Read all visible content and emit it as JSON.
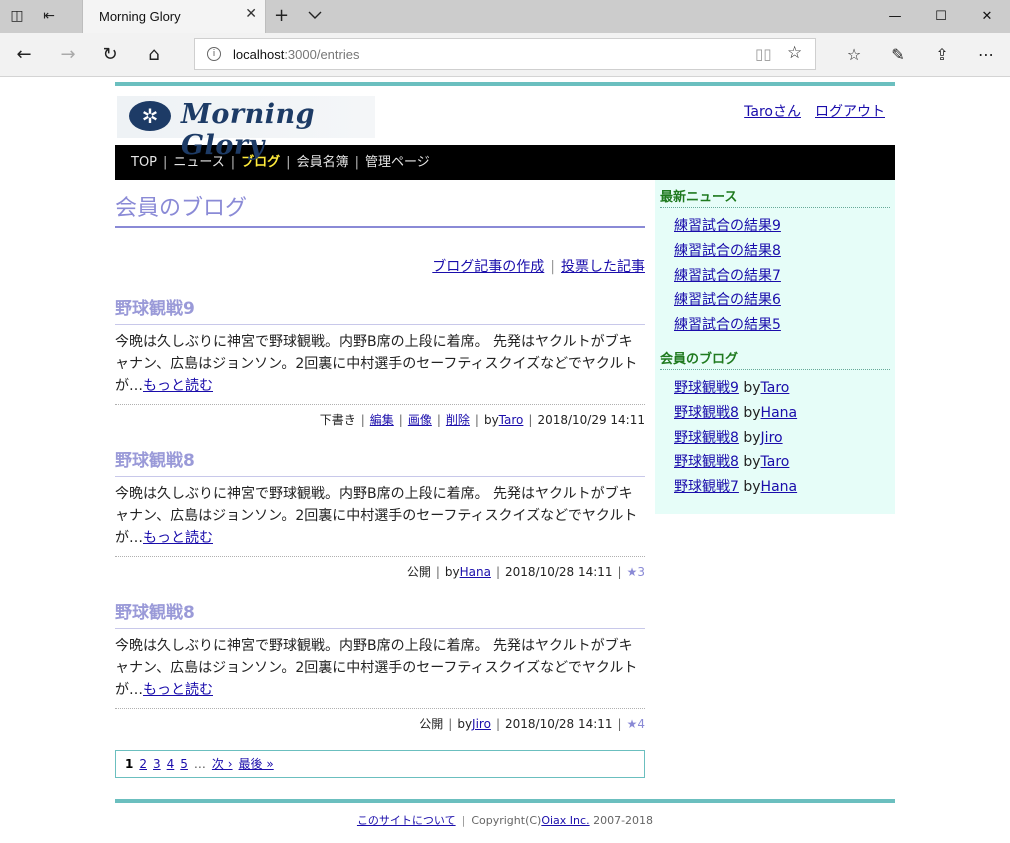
{
  "browser": {
    "tab_title": "Morning Glory",
    "url_host": "localhost",
    "url_path": ":3000/entries"
  },
  "site": {
    "logo_text": "Morning Glory",
    "user_link": "Taroさん",
    "logout_link": "ログアウト"
  },
  "nav": [
    "TOP",
    "ニュース",
    "ブログ",
    "会員名簿",
    "管理ページ"
  ],
  "main": {
    "title": "会員のブログ",
    "create_link": "ブログ記事の作成",
    "voted_link": "投票した記事",
    "read_more": "もっと読む",
    "entries": [
      {
        "title": "野球観戦9",
        "body": "今晩は久しぶりに神宮で野球観戦。内野B席の上段に着席。 先発はヤクルトがブキャナン、広島はジョンソン。2回裏に中村選手のセーフティスクイズなどでヤクルトが…",
        "status": "下書き",
        "edit": "編集",
        "image": "画像",
        "delete": "削除",
        "by": "by",
        "author": "Taro",
        "date": "2018/10/29 14:11"
      },
      {
        "title": "野球観戦8",
        "body": "今晩は久しぶりに神宮で野球観戦。内野B席の上段に着席。 先発はヤクルトがブキャナン、広島はジョンソン。2回裏に中村選手のセーフティスクイズなどでヤクルトが…",
        "status": "公開",
        "by": "by",
        "author": "Hana",
        "date": "2018/10/28 14:11",
        "stars": "★3"
      },
      {
        "title": "野球観戦8",
        "body": "今晩は久しぶりに神宮で野球観戦。内野B席の上段に着席。 先発はヤクルトがブキャナン、広島はジョンソン。2回裏に中村選手のセーフティスクイズなどでヤクルトが…",
        "status": "公開",
        "by": "by",
        "author": "Jiro",
        "date": "2018/10/28 14:11",
        "stars": "★4"
      }
    ],
    "pager": {
      "current": "1",
      "pages": [
        "2",
        "3",
        "4",
        "5"
      ],
      "dots": "…",
      "next": "次 ›",
      "last": "最後 »"
    }
  },
  "sidebar": {
    "news_head": "最新ニュース",
    "news": [
      "練習試合の結果9",
      "練習試合の結果8",
      "練習試合の結果7",
      "練習試合の結果6",
      "練習試合の結果5"
    ],
    "blog_head": "会員のブログ",
    "blogs": [
      {
        "title": "野球観戦9",
        "by": "by",
        "author": "Taro"
      },
      {
        "title": "野球観戦8",
        "by": "by",
        "author": "Hana"
      },
      {
        "title": "野球観戦8",
        "by": "by",
        "author": "Jiro"
      },
      {
        "title": "野球観戦8",
        "by": "by",
        "author": "Taro"
      },
      {
        "title": "野球観戦7",
        "by": "by",
        "author": "Hana"
      }
    ]
  },
  "footer": {
    "about": "このサイトについて",
    "copyright_prefix": "Copyright(C)",
    "company": "Oiax Inc.",
    "years": "2007-2018"
  },
  "colors": {
    "accent_line": "#6bbfbf",
    "title_purple": "#8a8ad6",
    "nav_active": "#ffeb3b",
    "sidebar_bg": "#e6fdf8"
  }
}
